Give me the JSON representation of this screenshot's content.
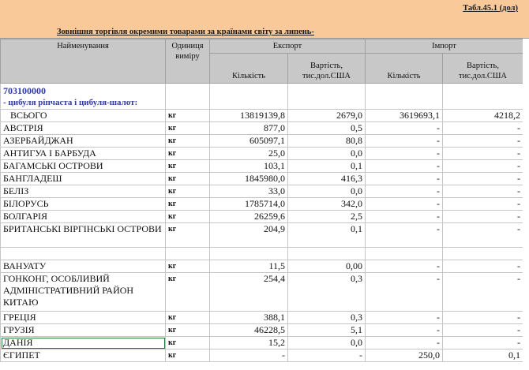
{
  "header": {
    "table_number": "Табл.45.1 (дол)",
    "title": "Зовнішня торгівля окремими товарами за країнами світу  за  липень-"
  },
  "columns": {
    "name": "Найменування",
    "unit": "Одиниця виміру",
    "export": "Експорт",
    "import": "Імпорт",
    "qty": "Кількість",
    "value": "Вартість, тис.дол.США"
  },
  "product": {
    "code": "703100000",
    "name": "- цибуля ріпчаста і цибуля-шалот:"
  },
  "rows": [
    {
      "name": "ВСЬОГО",
      "unit": "кг",
      "exp_qty": "13819139,8",
      "exp_val": "2679,0",
      "imp_qty": "3619693,1",
      "imp_val": "4218,2"
    },
    {
      "name": "АВСТРІЯ",
      "unit": "кг",
      "exp_qty": "877,0",
      "exp_val": "0,5",
      "imp_qty": "-",
      "imp_val": "-"
    },
    {
      "name": "АЗЕРБАЙДЖАН",
      "unit": "кг",
      "exp_qty": "605097,1",
      "exp_val": "80,8",
      "imp_qty": "-",
      "imp_val": "-"
    },
    {
      "name": "АНТИГУА І БАРБУДА",
      "unit": "кг",
      "exp_qty": "25,0",
      "exp_val": "0,0",
      "imp_qty": "-",
      "imp_val": "-"
    },
    {
      "name": "БАГАМСЬКІ ОСТРОВИ",
      "unit": "кг",
      "exp_qty": "103,1",
      "exp_val": "0,1",
      "imp_qty": "-",
      "imp_val": "-"
    },
    {
      "name": "БАНГЛАДЕШ",
      "unit": "кг",
      "exp_qty": "1845980,0",
      "exp_val": "416,3",
      "imp_qty": "-",
      "imp_val": "-"
    },
    {
      "name": "БЕЛІЗ",
      "unit": "кг",
      "exp_qty": "33,0",
      "exp_val": "0,0",
      "imp_qty": "-",
      "imp_val": "-"
    },
    {
      "name": "БІЛОРУСЬ",
      "unit": "кг",
      "exp_qty": "1785714,0",
      "exp_val": "342,0",
      "imp_qty": "-",
      "imp_val": "-"
    },
    {
      "name": "БОЛГАРІЯ",
      "unit": "кг",
      "exp_qty": "26259,6",
      "exp_val": "2,5",
      "imp_qty": "-",
      "imp_val": "-"
    },
    {
      "name": "БРИТАНСЬКІ ВІРГІНСЬКІ ОСТРОВИ",
      "unit": "кг",
      "exp_qty": "204,9",
      "exp_val": "0,1",
      "imp_qty": "-",
      "imp_val": "-"
    },
    {
      "name": "ВАНУАТУ",
      "unit": "кг",
      "exp_qty": "11,5",
      "exp_val": "0,00",
      "imp_qty": "-",
      "imp_val": "-"
    },
    {
      "name": "ГОНКОНГ, ОСОБЛИВИЙ АДМІНІСТРАТИВНИЙ РАЙОН КИТАЮ",
      "unit": "кг",
      "exp_qty": "254,4",
      "exp_val": "0,3",
      "imp_qty": "-",
      "imp_val": "-"
    },
    {
      "name": "ГРЕЦІЯ",
      "unit": "кг",
      "exp_qty": "388,1",
      "exp_val": "0,3",
      "imp_qty": "-",
      "imp_val": "-"
    },
    {
      "name": "ГРУЗІЯ",
      "unit": "кг",
      "exp_qty": "46228,5",
      "exp_val": "5,1",
      "imp_qty": "-",
      "imp_val": "-"
    },
    {
      "name": "ДАНІЯ",
      "unit": "кг",
      "exp_qty": "15,2",
      "exp_val": "0,0",
      "imp_qty": "-",
      "imp_val": "-"
    },
    {
      "name": "ЄГИПЕТ",
      "unit": "кг",
      "exp_qty": "-",
      "exp_val": "-",
      "imp_qty": "250,0",
      "imp_val": "0,1"
    }
  ],
  "colors": {
    "header_band": "#f9c99a",
    "header_grid": "#c8c8c8",
    "product_text": "#2f3aa0",
    "selection": "#1f7a3a"
  }
}
